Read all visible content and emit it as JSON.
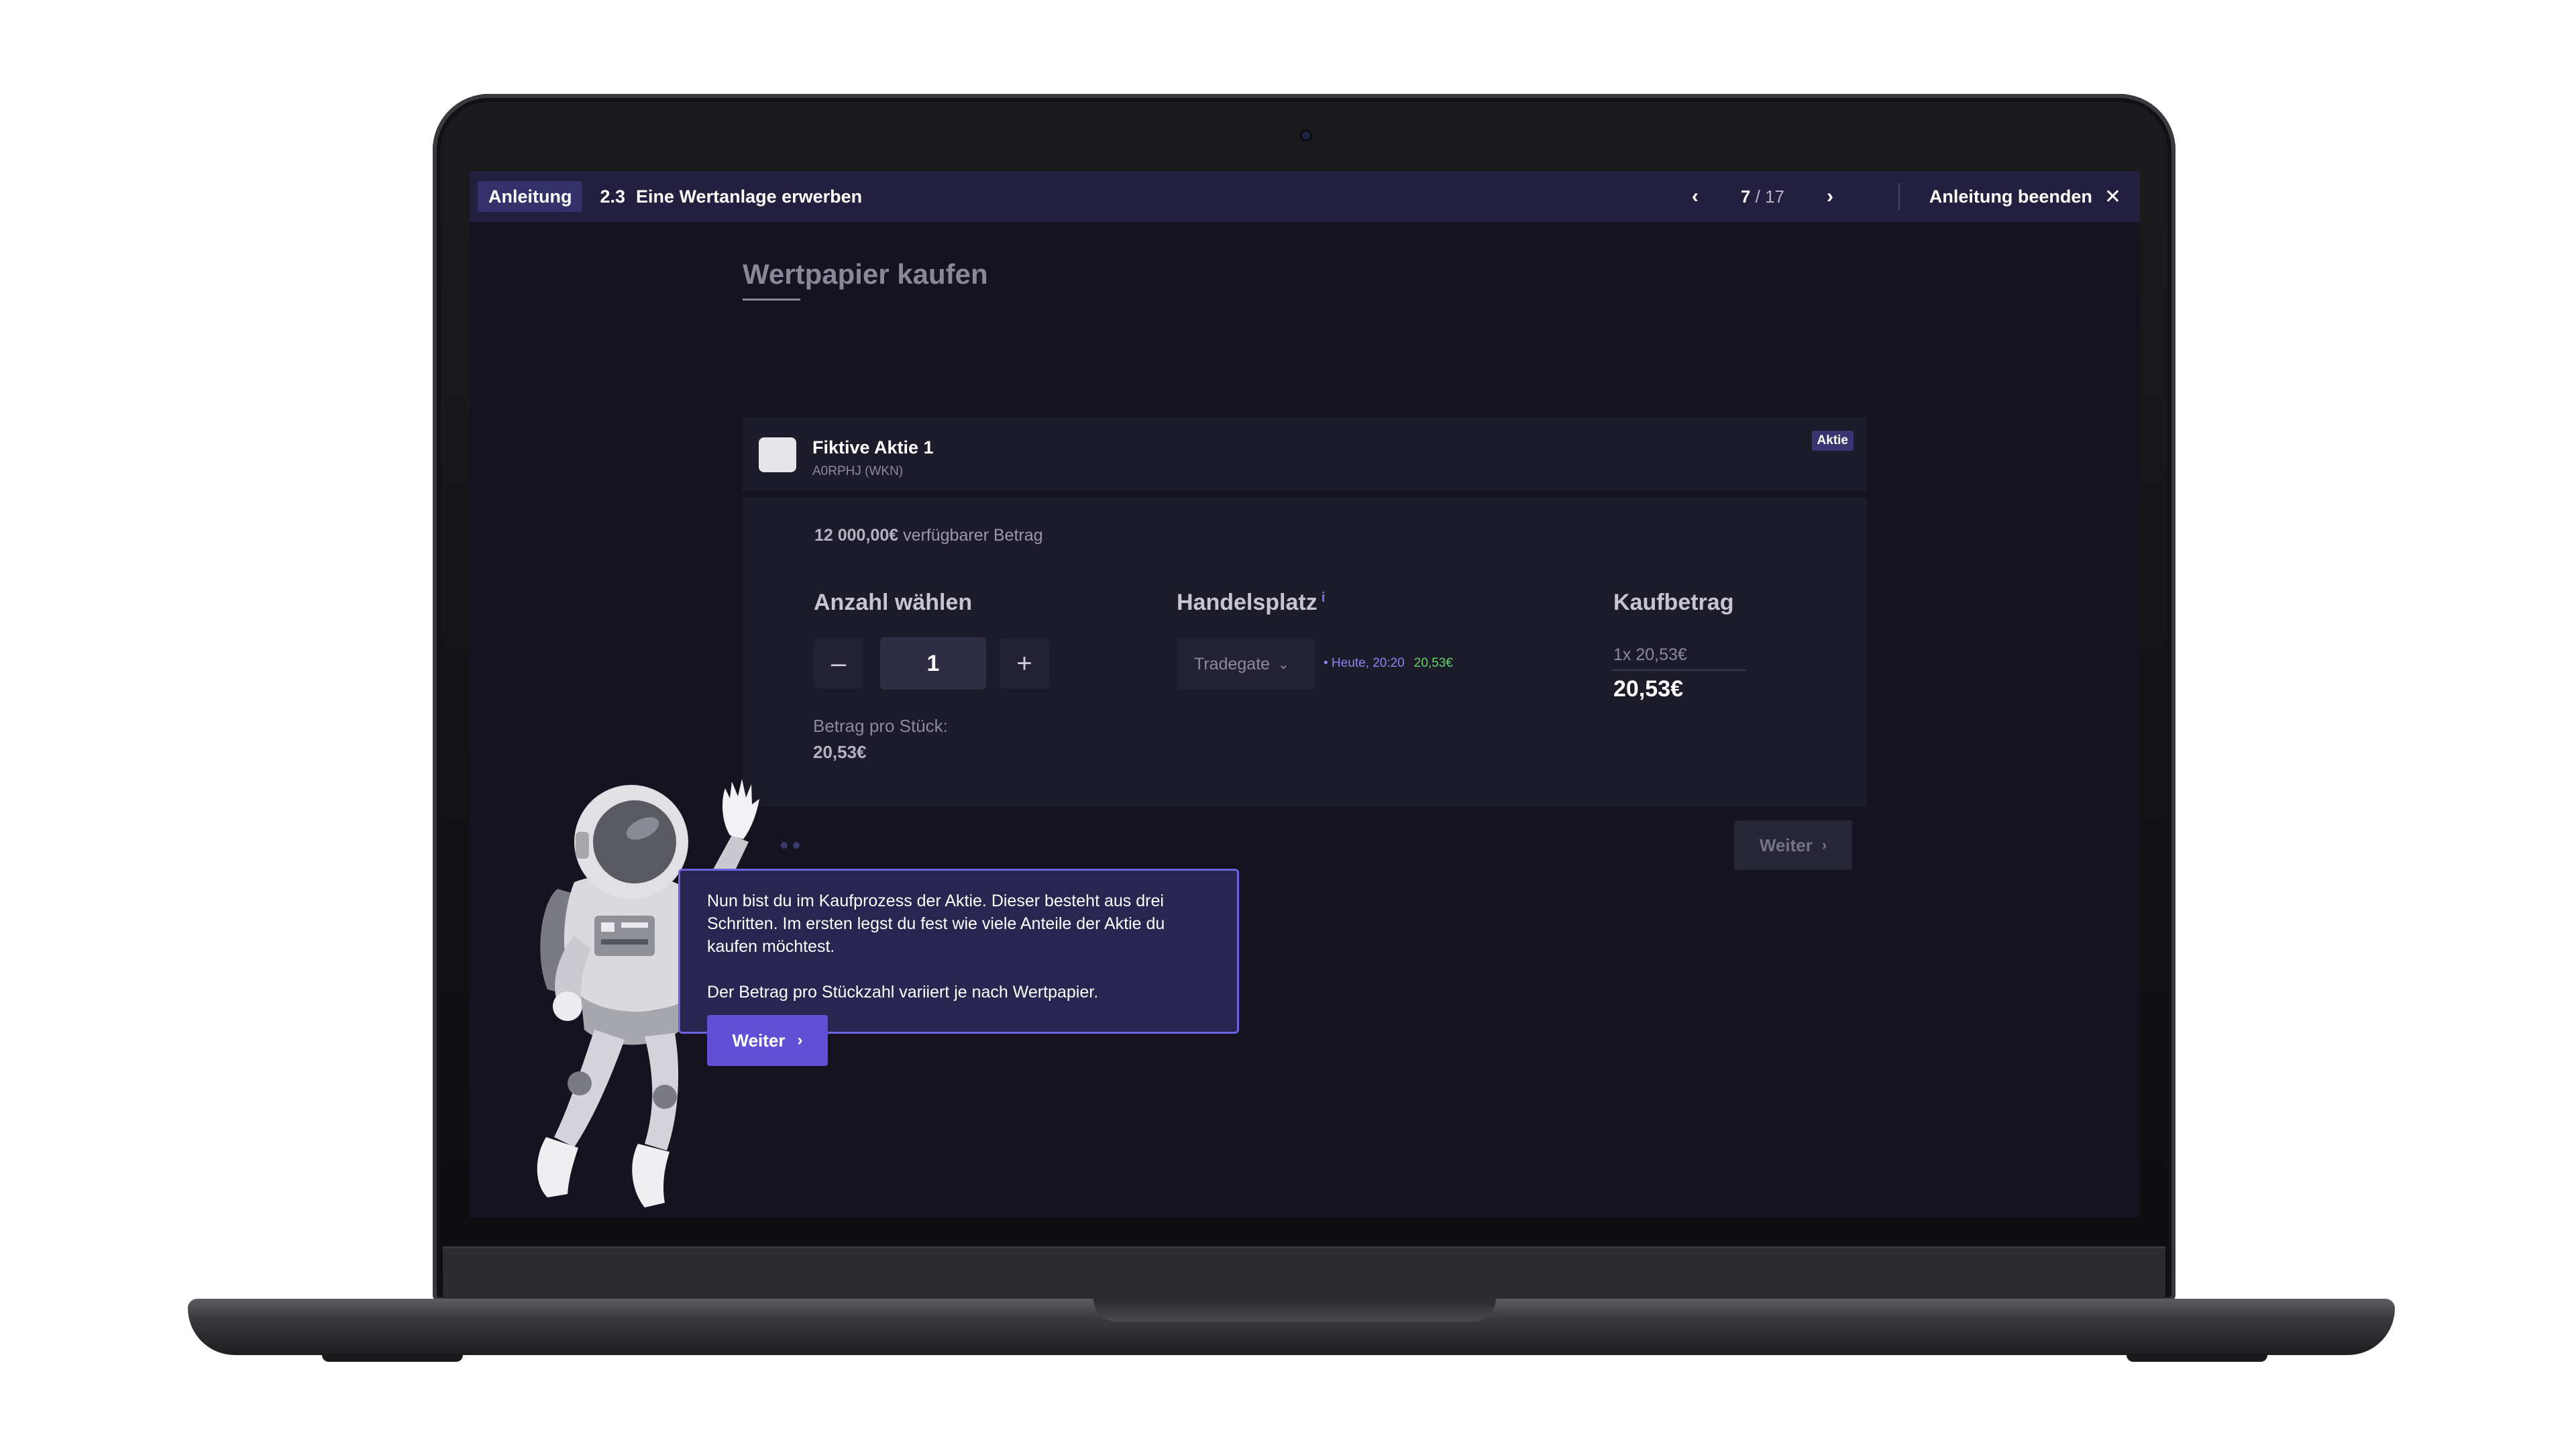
{
  "topbar": {
    "tag": "Anleitung",
    "step_num": "2.3",
    "step_title": "Eine Wertanlage erwerben",
    "page_current": "7",
    "page_total": "/ 17",
    "end_label": "Anleitung beenden"
  },
  "page": {
    "title": "Wertpapier kaufen"
  },
  "stock": {
    "name": "Fiktive Aktie 1",
    "wkn": "A0RPHJ (WKN)",
    "badge": "Aktie"
  },
  "buy": {
    "available_amount": "12 000,00€",
    "available_label": "verfügbarer Betrag",
    "qty_heading": "Anzahl wählen",
    "qty_minus": "–",
    "qty_value": "1",
    "qty_plus": "+",
    "per_unit_label": "Betrag pro Stück:",
    "per_unit_value": "20,53€",
    "venue_heading": "Handelsplatz",
    "venue_info": "i",
    "venue_selected": "Tradegate",
    "venue_time": "• Heute, 20:20",
    "venue_price": "20,53€",
    "sum_heading": "Kaufbetrag",
    "sum_line": "1x 20,53€",
    "sum_total": "20,53€",
    "next_label": "Weiter"
  },
  "tooltip": {
    "text_1": "Nun bist du im Kaufprozess der Aktie. Dieser besteht aus drei Schritten. Im ersten legst du fest wie viele Anteile der Aktie du kaufen möchtest.",
    "text_2": "Der Betrag pro Stückzahl variiert je nach Wertpapier.",
    "next_label": "Weiter"
  },
  "colors": {
    "accent": "#6150d6",
    "topbar": "#23203f",
    "screen_bg": "#14131f",
    "card_bg": "#1c1b2a",
    "price_green": "#63d16a"
  }
}
